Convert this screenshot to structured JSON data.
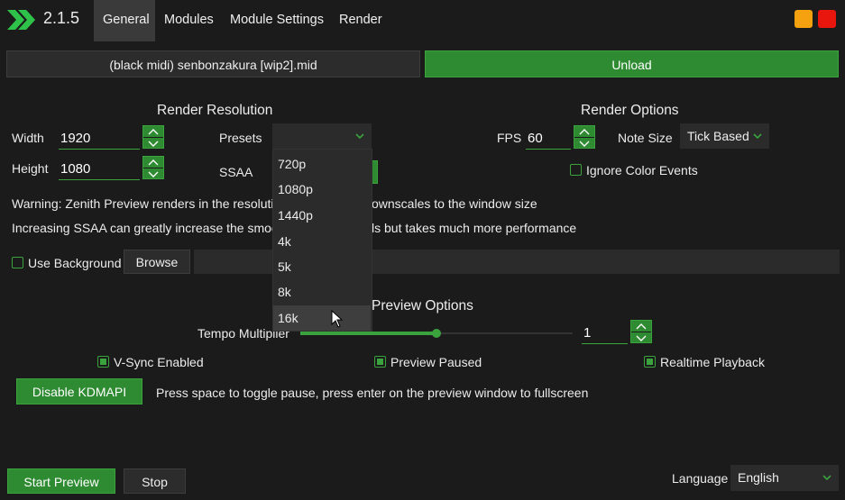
{
  "app": {
    "version": "2.1.5",
    "tabs": [
      {
        "label": "General",
        "active": true
      },
      {
        "label": "Modules"
      },
      {
        "label": "Module Settings"
      },
      {
        "label": "Render"
      }
    ],
    "colors": {
      "accent": "#2e8b32",
      "minimize": "#f6a10f",
      "close": "#e8160c"
    }
  },
  "file": {
    "name": "(black midi) senbonzakura [wip2].mid",
    "unload_label": "Unload"
  },
  "render_resolution": {
    "heading": "Render Resolution",
    "width_label": "Width",
    "width_value": "1920",
    "height_label": "Height",
    "height_value": "1080",
    "presets_label": "Presets",
    "presets_value": "",
    "presets_options": [
      "720p",
      "1080p",
      "1440p",
      "4k",
      "5k",
      "8k",
      "16k"
    ],
    "hovered_option": "16k",
    "ssaa_label": "SSAA"
  },
  "render_options": {
    "heading": "Render Options",
    "fps_label": "FPS",
    "fps_value": "60",
    "note_size_label": "Note Size",
    "note_size_value": "Tick Based",
    "ignore_color_label": "Ignore Color Events",
    "ignore_color_checked": false
  },
  "warnings": {
    "line1_a": "Warning: Zenith Preview renders in the resolutio",
    "line1_b": "ownscales to the window size",
    "line2_a": "Increasing SSAA can greatly increase the smoot",
    "line2_b": "ls but takes much more performance"
  },
  "background": {
    "use_label": "Use Background",
    "use_checked": false,
    "browse_label": "Browse",
    "path_value": ""
  },
  "preview_options": {
    "heading": "Preview Options",
    "tempo_label": "Tempo Multiplier",
    "tempo_value": "1",
    "tempo_slider_fraction": 0.5,
    "vsync_label": "V-Sync Enabled",
    "vsync_checked": true,
    "paused_label": "Preview Paused",
    "paused_checked": true,
    "realtime_label": "Realtime Playback",
    "realtime_checked": true,
    "kdmapi_label": "Disable KDMAPI",
    "hint": "Press space to toggle pause, press enter on the preview window to fullscreen"
  },
  "footer": {
    "start_label": "Start Preview",
    "stop_label": "Stop",
    "language_label": "Language",
    "language_value": "English"
  }
}
